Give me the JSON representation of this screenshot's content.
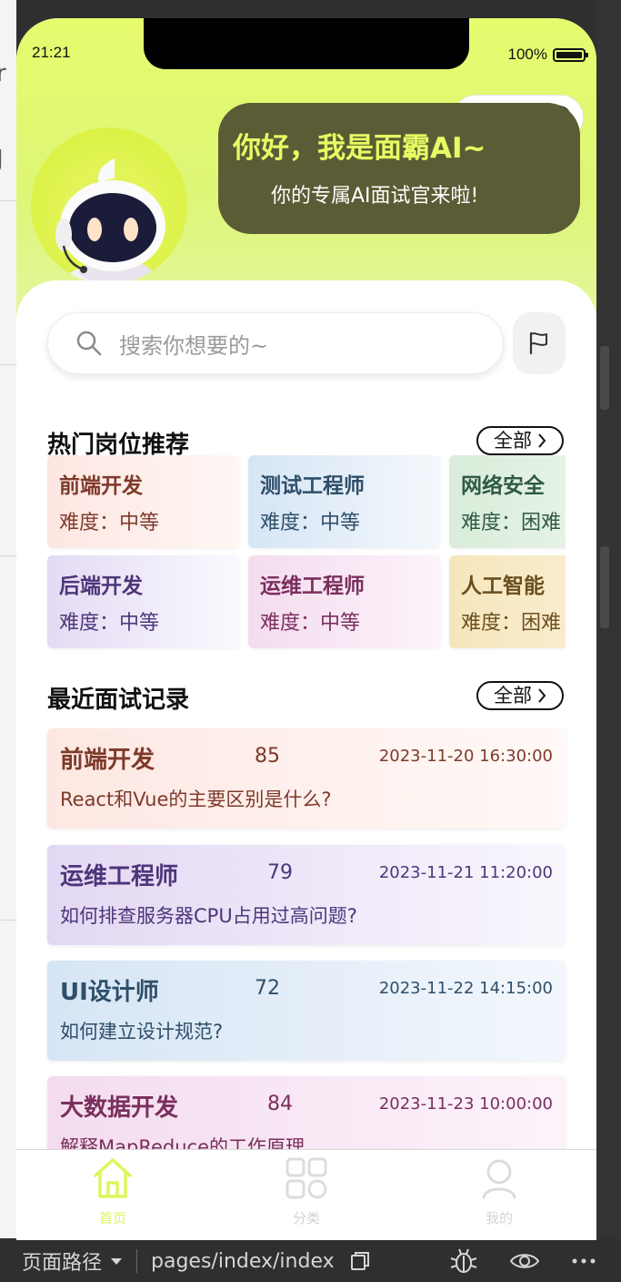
{
  "status": {
    "time": "21:21",
    "battery": "100%"
  },
  "greeting": {
    "title": "你好，我是面霸AI~",
    "subtitle": "你的专属AI面试官来啦!"
  },
  "search": {
    "placeholder": "搜索你想要的~"
  },
  "hot_jobs": {
    "title": "热门岗位推荐",
    "all_label": "全部",
    "items": [
      {
        "title": "前端开发",
        "difficulty": "难度：中等"
      },
      {
        "title": "测试工程师",
        "difficulty": "难度：中等"
      },
      {
        "title": "网络安全",
        "difficulty": "难度：困难"
      },
      {
        "title": "后端开发",
        "difficulty": "难度：中等"
      },
      {
        "title": "运维工程师",
        "difficulty": "难度：中等"
      },
      {
        "title": "人工智能",
        "difficulty": "难度：困难"
      }
    ]
  },
  "records": {
    "title": "最近面试记录",
    "all_label": "全部",
    "items": [
      {
        "job": "前端开发",
        "score": "85",
        "date": "2023-11-20 16:30:00",
        "question": "React和Vue的主要区别是什么?"
      },
      {
        "job": "运维工程师",
        "score": "79",
        "date": "2023-11-21 11:20:00",
        "question": "如何排查服务器CPU占用过高问题?"
      },
      {
        "job": "UI设计师",
        "score": "72",
        "date": "2023-11-22 14:15:00",
        "question": "如何建立设计规范?"
      },
      {
        "job": "大数据开发",
        "score": "84",
        "date": "2023-11-23 10:00:00",
        "question": "解释MapReduce的工作原理"
      }
    ]
  },
  "tabbar": [
    {
      "label": "首页",
      "icon": "home-icon",
      "active": true
    },
    {
      "label": "分类",
      "icon": "category-icon",
      "active": false
    },
    {
      "label": "我的",
      "icon": "user-icon",
      "active": false
    }
  ],
  "ide_footer": {
    "path_label": "页面路径",
    "path": "pages/index/index"
  },
  "colors": {
    "accent": "#e2f84d",
    "greeting_bg": "#5b5c35",
    "greeting_title": "#e7fb64"
  }
}
